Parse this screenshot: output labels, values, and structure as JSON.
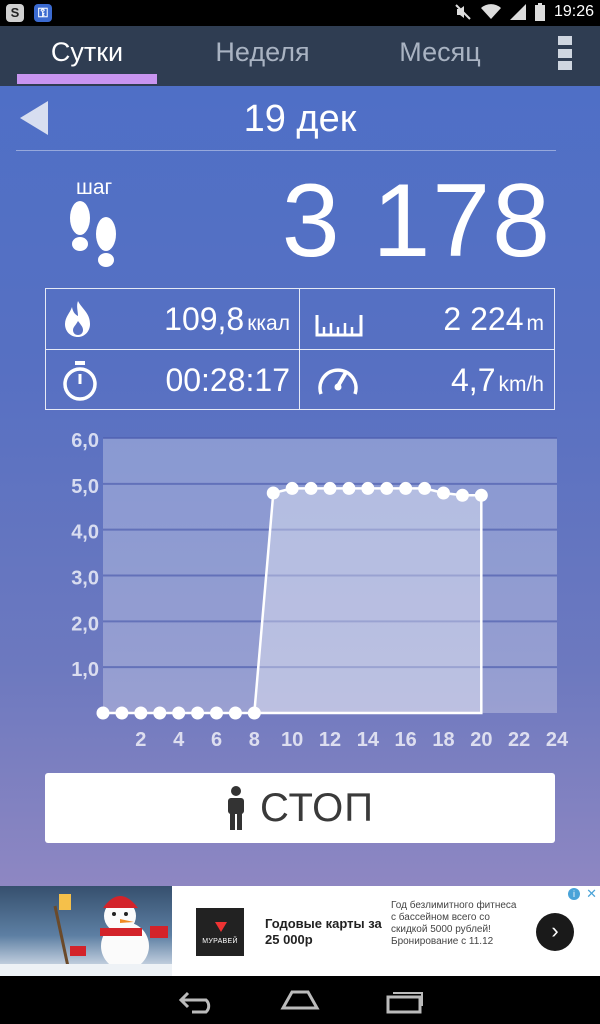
{
  "status_bar": {
    "left_icons": [
      "skype-icon",
      "vpn-key-icon"
    ],
    "right_icons": [
      "mute-icon",
      "wifi-icon",
      "signal-icon",
      "battery-icon"
    ],
    "time": "19:26"
  },
  "tabs": [
    {
      "label": "Сутки",
      "active": true
    },
    {
      "label": "Неделя",
      "active": false
    },
    {
      "label": "Месяц",
      "active": false
    }
  ],
  "accent_color": "#c895f0",
  "date": "19 дек",
  "steps": {
    "label": "шаг",
    "value": "3 178"
  },
  "stats": {
    "calories": {
      "value": "109,8",
      "unit": "ккал"
    },
    "distance": {
      "value": "2 224",
      "unit": "m"
    },
    "duration": {
      "value": "00:28:17"
    },
    "speed": {
      "value": "4,7",
      "unit": "km/h"
    }
  },
  "chart_data": {
    "type": "area",
    "x": [
      0,
      1,
      2,
      3,
      4,
      5,
      6,
      7,
      8,
      9,
      10,
      11,
      12,
      13,
      14,
      15,
      16,
      17,
      18,
      19,
      20
    ],
    "values": [
      0,
      0,
      0,
      0,
      0,
      0,
      0,
      0,
      0,
      4.8,
      4.9,
      4.9,
      4.9,
      4.9,
      4.9,
      4.9,
      4.9,
      4.9,
      4.8,
      4.75,
      4.75
    ],
    "xlim": [
      0,
      24
    ],
    "ylim": [
      0,
      6
    ],
    "xticks": [
      "2",
      "4",
      "6",
      "8",
      "10",
      "12",
      "14",
      "16",
      "18",
      "20",
      "22",
      "24"
    ],
    "yticks": [
      "1,0",
      "2,0",
      "3,0",
      "4,0",
      "5,0",
      "6,0"
    ],
    "grid": true
  },
  "stop_button": {
    "label": "СТОП"
  },
  "ad": {
    "logo_text": "МУРАВЕЙ",
    "headline": "Годовые карты за 25 000р",
    "body": "Год безлимитного фитнеса с бассейном всего со скидкой 5000 рублей! Бронирование с 11.12",
    "next_symbol": "›",
    "info_symbol": "i",
    "close_symbol": "✕"
  }
}
